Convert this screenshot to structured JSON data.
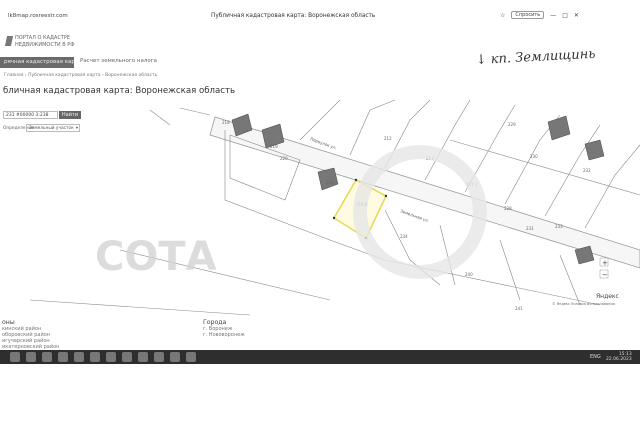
{
  "browser": {
    "url": "lk8map.rosreestr.com",
    "window_title": "Публичная кадастровая карта: Воронежская область",
    "site_button": "Спросить"
  },
  "logo": {
    "line1": "ПОРТАЛ О КАДАСТРЕ",
    "line2": "НЕДВИЖИМОСТИ В РФ"
  },
  "handwriting": "↓ кп. Землищинь",
  "nav": {
    "active_tab": "рячная кадастровая карта",
    "tab2": "Расчет земельного налога"
  },
  "breadcrumbs": "Главная  ›  Публичная кадастровая карта  ›  Воронежская область",
  "page_title": "бличная кадастровая карта: Воронежская область",
  "search": {
    "value": "231 #00000 3:238",
    "button": "Найти"
  },
  "filter": {
    "label": "Определение",
    "value": "Земельный участок"
  },
  "map": {
    "street1": "Переулок ул.",
    "street2": "Земельная ул.",
    "lots": [
      "218",
      "219",
      "220",
      "221",
      "212",
      "213",
      "216",
      "217",
      "219.6",
      "227.1",
      "228",
      "229",
      "230",
      "231",
      "232",
      "233",
      "234",
      "235",
      "236",
      "240",
      "241"
    ],
    "watermark": "СОТА",
    "yandex": "Яндекс",
    "yandex_small": "© Яндекс  Условия использования",
    "zoom_in": "+",
    "zoom_out": "−",
    "selected_color": "#e8d95a"
  },
  "bottom": {
    "districts_heading": "оны",
    "districts": [
      "кинский район",
      "оборовский район",
      "игучарский район",
      "икатерновский район"
    ],
    "cities_heading": "Города",
    "cities": [
      "г. Воронеж",
      "г. Нововоронеж"
    ]
  },
  "taskbar": {
    "lang": "ENG",
    "time": "15:13",
    "date": "22.06.2023"
  }
}
